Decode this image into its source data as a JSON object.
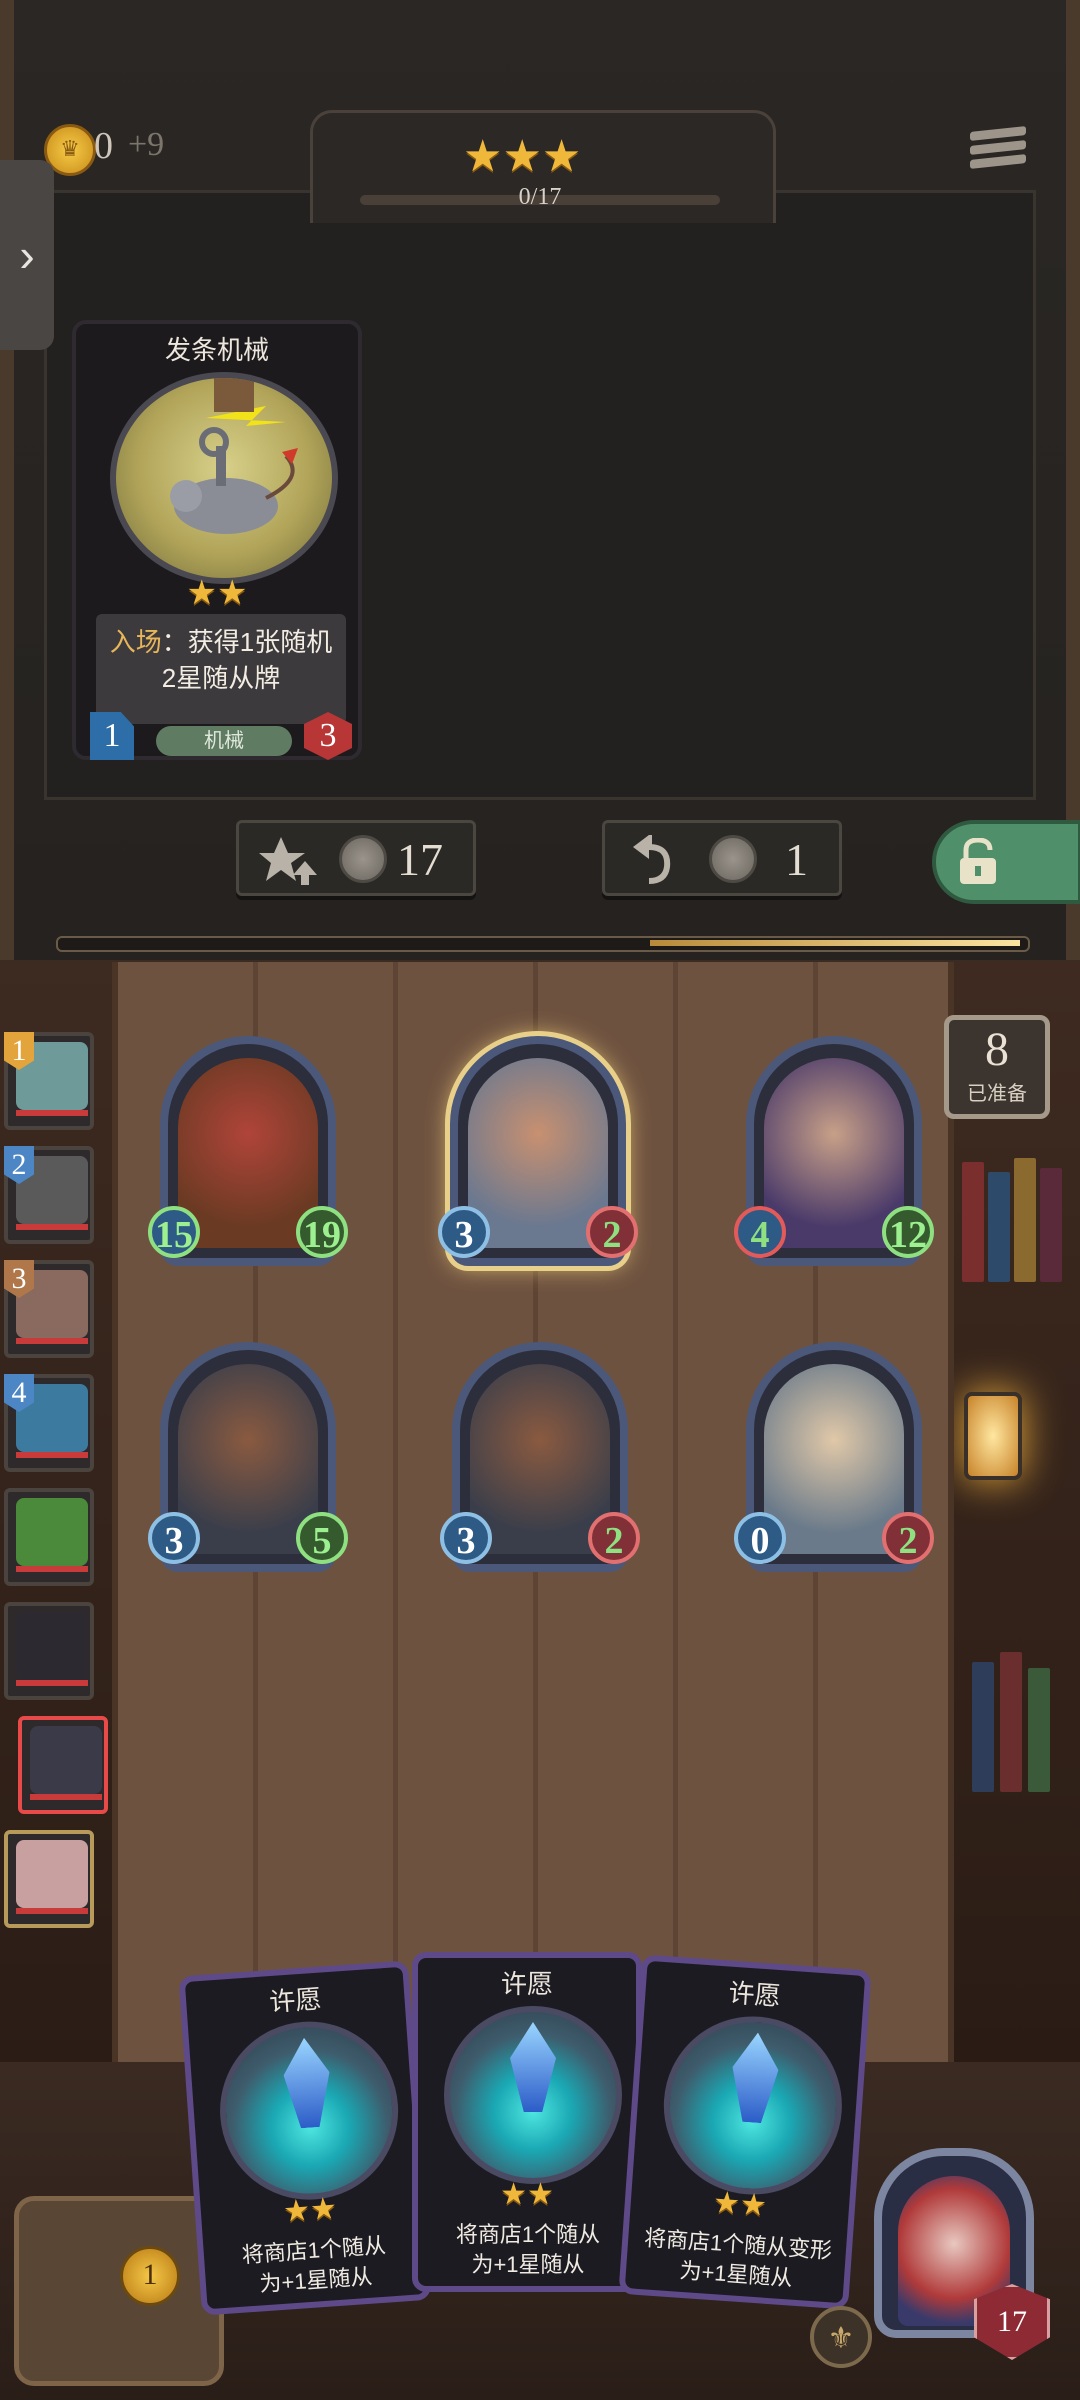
{
  "hud": {
    "gold": "0",
    "gold_income": "+9",
    "tier_stars": "★★★",
    "exp_progress": "0/17"
  },
  "shop_card": {
    "name": "发条机械",
    "stars": "★★",
    "keyword": "入场",
    "text_line1": "：获得1张随机",
    "text_line2": "2星随从牌",
    "attack": "1",
    "health": "3",
    "tribe": "机械"
  },
  "buttons": {
    "upgrade_cost": "17",
    "refresh_cost": "1"
  },
  "ready": {
    "count": "8",
    "label": "已准备"
  },
  "lobby": [
    {
      "rank": "1",
      "color": "#e3a43c"
    },
    {
      "rank": "2",
      "color": "#4c86c4"
    },
    {
      "rank": "3",
      "color": "#b0784a"
    },
    {
      "rank": "4",
      "color": "#4c86c4"
    },
    {
      "rank": "",
      "color": ""
    },
    {
      "rank": "",
      "color": ""
    },
    {
      "rank": "",
      "color": ""
    },
    {
      "rank": "",
      "color": ""
    }
  ],
  "board": [
    {
      "attack": "15",
      "health": "19"
    },
    {
      "attack": "3",
      "health": "2"
    },
    {
      "attack": "4",
      "health": "12"
    },
    {
      "attack": "3",
      "health": "5"
    },
    {
      "attack": "3",
      "health": "2"
    },
    {
      "attack": "0",
      "health": "2"
    }
  ],
  "hand": [
    {
      "title": "许愿",
      "stars": "★★",
      "line1": "将商店1个随从",
      "line2": "为+1星随从"
    },
    {
      "title": "许愿",
      "stars": "★★",
      "line1": "将商店1个随从",
      "line2": "为+1星随从"
    },
    {
      "title": "许愿",
      "stars": "★★",
      "line1": "将商店1个随从变形",
      "line2": "为+1星随从"
    }
  ],
  "hero": {
    "health": "17"
  },
  "reroll": {
    "cost": "1"
  }
}
